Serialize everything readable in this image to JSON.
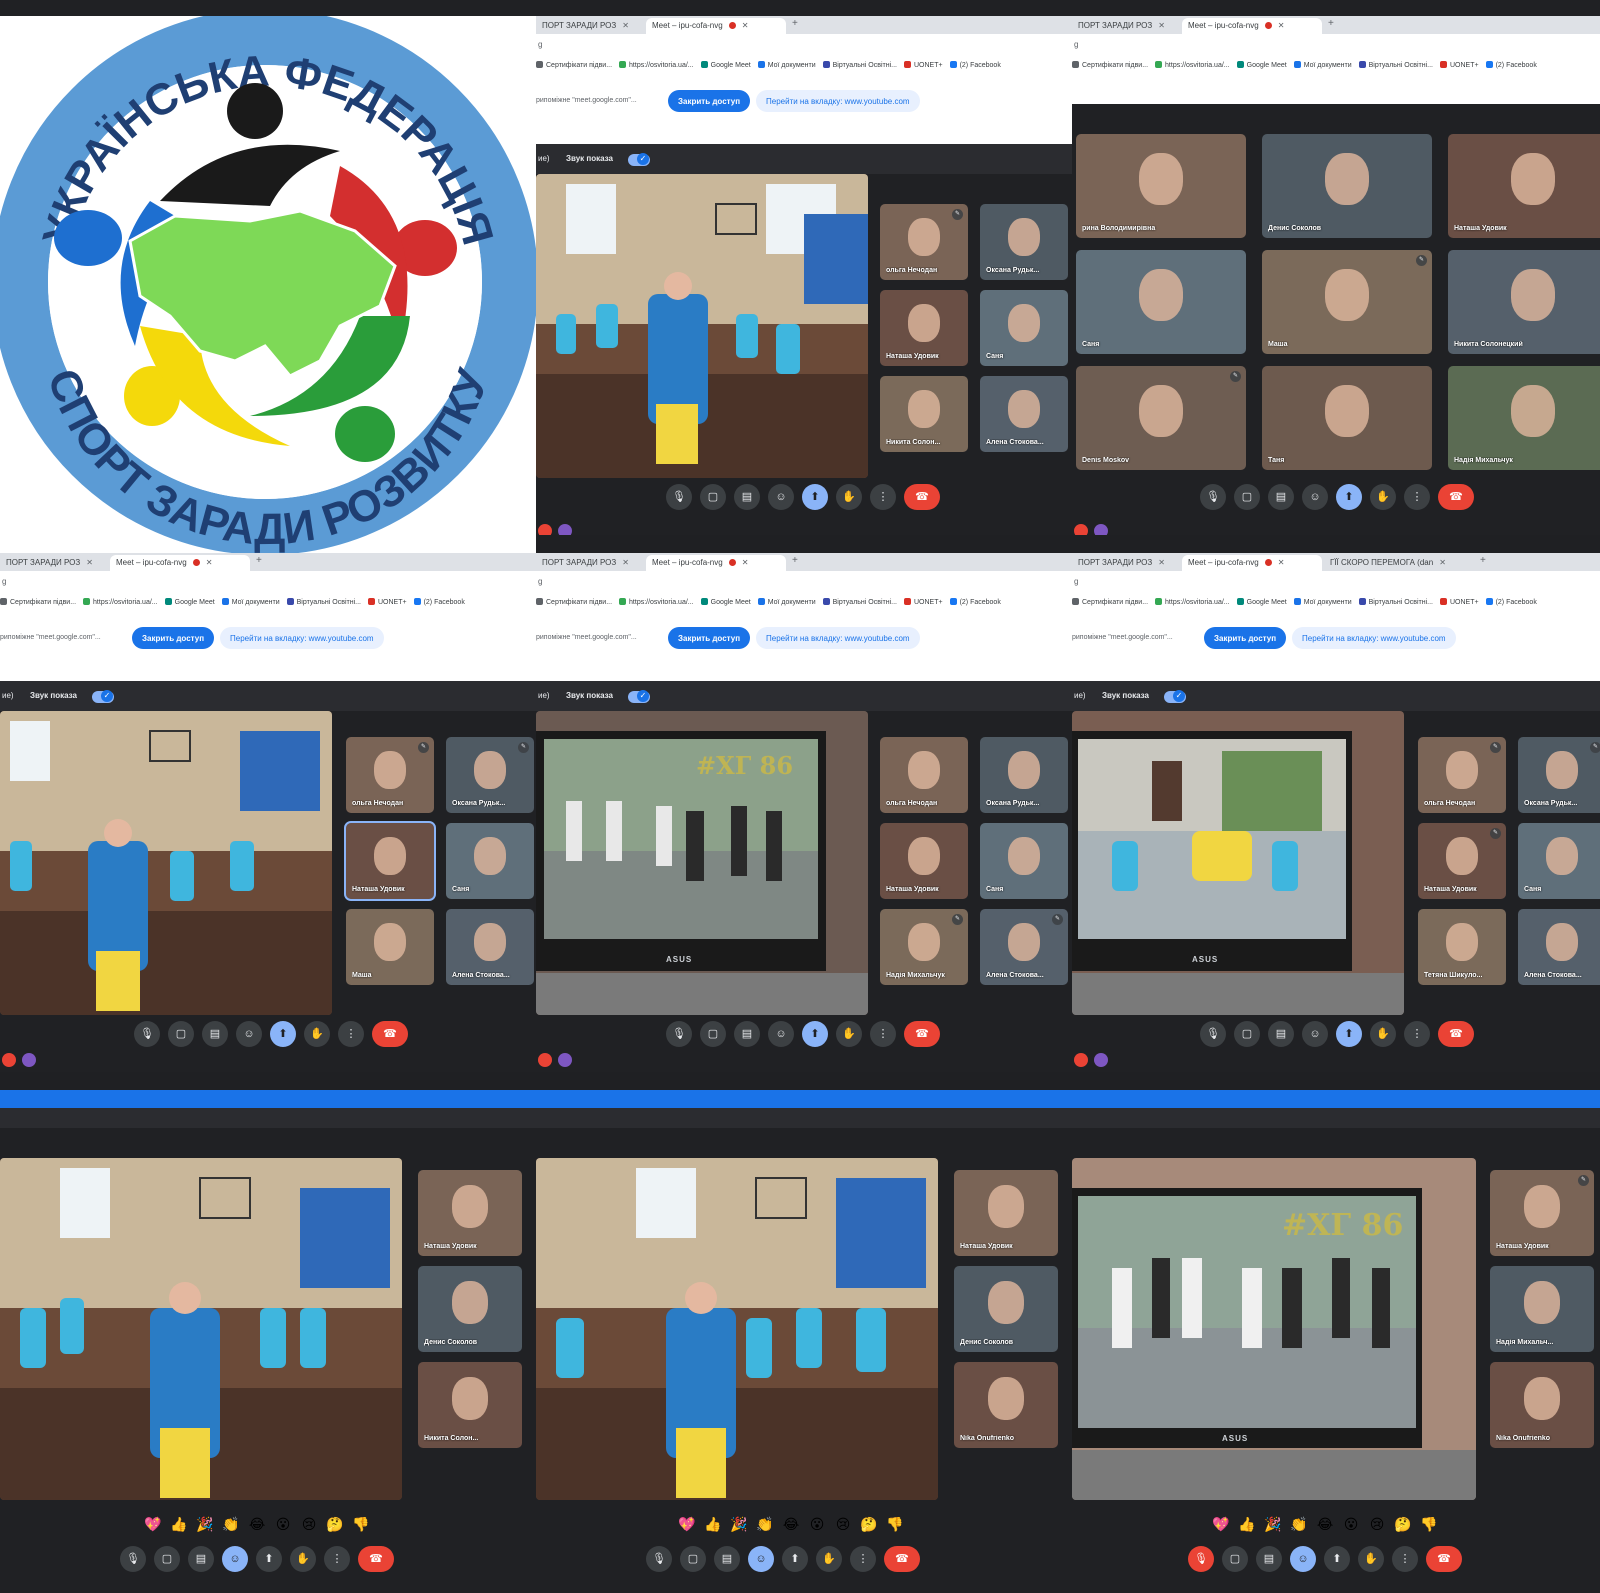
{
  "logo": {
    "top_text": "УКРАЇНСЬКА ФЕДЕРАЦІЯ",
    "bottom_text": "СПОРТ ЗАРАДИ РОЗВИТКУ",
    "colors": {
      "ring": "#5b9bd5",
      "black": "#1a1a1a",
      "red": "#d32f2f",
      "blue": "#1e6fd0",
      "yellow": "#f4d90b",
      "green": "#2a9d3a",
      "map": "#7ed957"
    }
  },
  "browser": {
    "tab_sport": "ПОРТ ЗАРАДИ РОЗ",
    "tab_meet": "Meet – ipu-cofa-nvg",
    "tab_youtube": "ГЇЇ СКОРО ПЕРЕМОГА (dan",
    "tab_plus": "+",
    "address_char": "g",
    "bookmarks": [
      {
        "label": "Сертифікати підви...",
        "color": "#5f6368"
      },
      {
        "label": "https://osvitoria.ua/...",
        "color": "#34a853"
      },
      {
        "label": "Google Meet",
        "color": "#00897b"
      },
      {
        "label": "Мої документи",
        "color": "#1a73e8"
      },
      {
        "label": "Віртуальні Освітні...",
        "color": "#3949ab"
      },
      {
        "label": "UONET+",
        "color": "#d93025"
      },
      {
        "label": "(2) Facebook",
        "color": "#1877f2"
      }
    ],
    "share_text": "рипоміжне \"meet.google.com\"...",
    "stop_sharing": "Закрить доступ",
    "goto_tab": "Перейти на вкладку: www.youtube.com",
    "sound_prefix": "ие)",
    "sound_label": "Звук показа"
  },
  "shots": {
    "s1": {
      "tiles": [
        {
          "name": "ольга Нечодан",
          "mute": true
        },
        {
          "name": "Оксана Рудьк...",
          "mute": false
        },
        {
          "name": "Наташа Удовик",
          "mute": false
        },
        {
          "name": "Саня",
          "mute": false
        },
        {
          "name": "Никита Солон...",
          "mute": false
        },
        {
          "name": "Алена Стокова...",
          "mute": false
        }
      ]
    },
    "s2": {
      "tiles": [
        {
          "name": "рина Володимирівна",
          "mute": false
        },
        {
          "name": "Денис Соколов",
          "mute": false
        },
        {
          "name": "Наташа Удовик",
          "mute": false
        },
        {
          "name": "Саня",
          "mute": false
        },
        {
          "name": "Маша",
          "mute": true
        },
        {
          "name": "Никита Солонецкий",
          "mute": false
        },
        {
          "name": "Denis Moskov",
          "mute": true
        },
        {
          "name": "Таня",
          "mute": false
        },
        {
          "name": "Надія Михальчук",
          "mute": false
        }
      ]
    },
    "s3": {
      "tiles": [
        {
          "name": "ольга Нечодан",
          "mute": true
        },
        {
          "name": "Оксана Рудьк...",
          "mute": true
        },
        {
          "name": "Наташа Удовик",
          "mute": false
        },
        {
          "name": "Саня",
          "mute": false
        },
        {
          "name": "Маша",
          "mute": false
        },
        {
          "name": "Алена Стокова...",
          "mute": false
        }
      ]
    },
    "s4": {
      "hashtag": "#ХГ 86",
      "laptop": "ASUS",
      "tiles": [
        {
          "name": "ольга Нечодан",
          "mute": false
        },
        {
          "name": "Оксана Рудьк...",
          "mute": false
        },
        {
          "name": "Наташа Удовик",
          "mute": false
        },
        {
          "name": "Саня",
          "mute": false
        },
        {
          "name": "Надія Михальчук",
          "mute": true
        },
        {
          "name": "Алена Стокова...",
          "mute": true
        }
      ]
    },
    "s5": {
      "laptop": "ASUS",
      "tiles": [
        {
          "name": "ольга Нечодан",
          "mute": true
        },
        {
          "name": "Оксана Рудьк...",
          "mute": true
        },
        {
          "name": "Наташа Удовик",
          "mute": true
        },
        {
          "name": "Саня",
          "mute": false
        },
        {
          "name": "Тетяна Шикуло...",
          "mute": false
        },
        {
          "name": "Алена Стокова...",
          "mute": false
        }
      ]
    },
    "s6": {
      "tiles": [
        {
          "name": "Наташа Удовик",
          "mute": false
        },
        {
          "name": "Денис Соколов",
          "mute": false
        },
        {
          "name": "Никита Солон...",
          "mute": false
        }
      ]
    },
    "s7": {
      "tiles": [
        {
          "name": "Наташа Удовик",
          "mute": false
        },
        {
          "name": "Денис Соколов",
          "mute": false
        },
        {
          "name": "Nika Onufrienko",
          "mute": false
        }
      ]
    },
    "s8": {
      "hashtag": "#ХГ 86",
      "laptop": "ASUS",
      "tiles": [
        {
          "name": "Наташа Удовик",
          "mute": true
        },
        {
          "name": "Надія Михальч...",
          "mute": false
        },
        {
          "name": "Nika Onufrienko",
          "mute": false
        }
      ]
    }
  },
  "reactions": [
    "💖",
    "👍",
    "🎉",
    "👏",
    "😂",
    "😮",
    "😢",
    "🤔",
    "👎"
  ],
  "controls": {
    "mic": "🎙",
    "camera": "▢",
    "captions": "▤",
    "emoji": "☺",
    "present": "⬆",
    "hand": "✋",
    "more": "⋮",
    "hangup": "☎"
  }
}
